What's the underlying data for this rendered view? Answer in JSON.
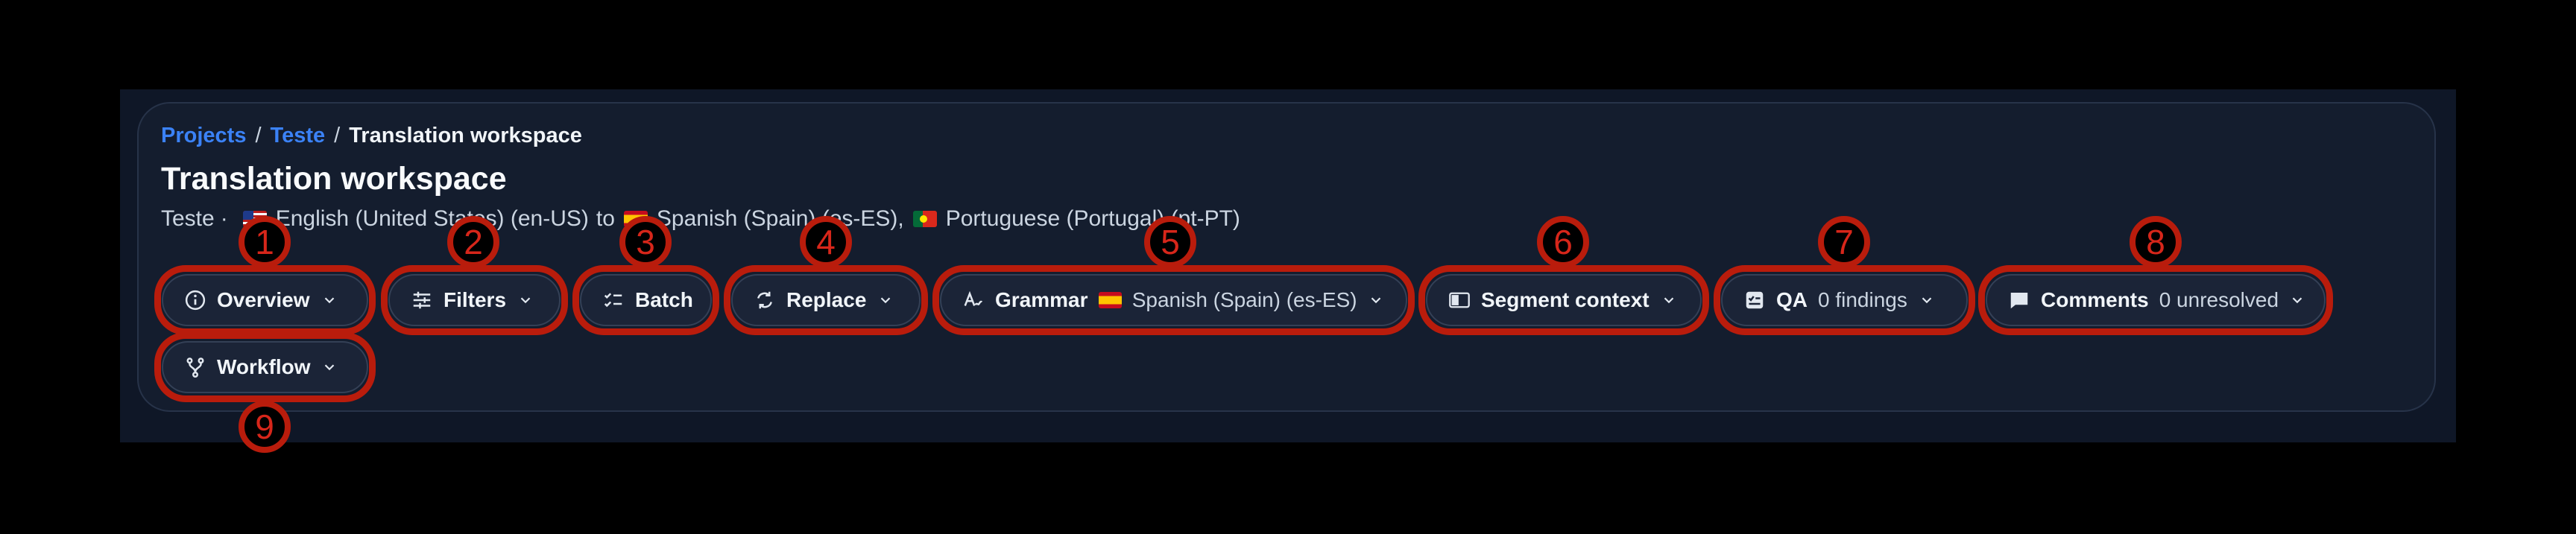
{
  "breadcrumb": {
    "projects": "Projects",
    "project": "Teste",
    "separator": "/",
    "current": "Translation workspace"
  },
  "page": {
    "title": "Translation workspace",
    "subtitle": {
      "project": "Teste",
      "dot": "·",
      "source": "English (United States) (en-US)",
      "to": "to",
      "target1": "Spanish (Spain) (es-ES),",
      "target2": "Portuguese (Portugal) (pt-PT)"
    }
  },
  "toolbar": {
    "overview": {
      "label": "Overview",
      "icon": "info-icon"
    },
    "filters": {
      "label": "Filters",
      "icon": "sliders-icon"
    },
    "batch": {
      "label": "Batch",
      "icon": "checklist-icon"
    },
    "replace": {
      "label": "Replace",
      "icon": "replace-icon"
    },
    "grammar": {
      "label": "Grammar",
      "value": "Spanish (Spain) (es-ES)",
      "icon": "spellcheck-icon"
    },
    "segment_context": {
      "label": "Segment context",
      "icon": "sidebar-panel-icon"
    },
    "qa": {
      "label": "QA",
      "value": "0 findings",
      "icon": "qa-icon"
    },
    "comments": {
      "label": "Comments",
      "value": "0 unresolved",
      "icon": "comment-icon"
    },
    "workflow": {
      "label": "Workflow",
      "icon": "branch-icon"
    }
  },
  "annotations": [
    "1",
    "2",
    "3",
    "4",
    "5",
    "6",
    "7",
    "8",
    "9"
  ],
  "colors": {
    "link": "#3b82f6",
    "panel": "#141d2e",
    "button": "#1b2437",
    "annotation": "#b91c0c"
  }
}
